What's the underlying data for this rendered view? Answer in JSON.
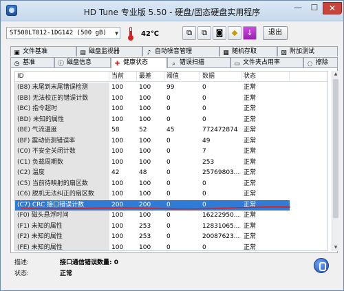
{
  "window": {
    "title": "HD Tune 专业版 5.50 - 硬盘/固态硬盘实用程序"
  },
  "titlebar_buttons": {
    "minimize": "—",
    "maximize": "☐",
    "close": "✕"
  },
  "toolbar": {
    "drive": "ST500LT012-1DG142 (500 gB)",
    "temperature": "42℃",
    "exit_label": "退出",
    "tool_icons": [
      "copy-icon",
      "copy-icon",
      "camera-icon",
      "save-icon",
      "download-icon"
    ],
    "tool_glyphs": [
      "⧉",
      "⧉",
      "◙",
      "◆",
      "↓"
    ]
  },
  "tabs_row1": [
    {
      "label": "文件基准",
      "icon": "file-benchmark-icon",
      "glyph": "▣"
    },
    {
      "label": "磁盘监视器",
      "icon": "disk-monitor-icon",
      "glyph": "▤"
    },
    {
      "label": "自动噪音管理",
      "icon": "noise-icon",
      "glyph": "♪"
    },
    {
      "label": "随机存取",
      "icon": "random-access-icon",
      "glyph": "▦"
    },
    {
      "label": "附加测试",
      "icon": "extra-tests-icon",
      "glyph": "▧"
    }
  ],
  "tabs_row2": [
    {
      "label": "基准",
      "icon": "benchmark-icon",
      "glyph": "◷"
    },
    {
      "label": "磁盘信息",
      "icon": "disk-info-icon",
      "glyph": "ⓘ"
    },
    {
      "label": "健康状态",
      "icon": "health-icon",
      "glyph": "✚"
    },
    {
      "label": "错误扫描",
      "icon": "error-scan-icon",
      "glyph": "⌕"
    },
    {
      "label": "文件夹占用率",
      "icon": "folder-usage-icon",
      "glyph": "▭"
    },
    {
      "label": "擦除",
      "icon": "erase-icon",
      "glyph": "◌"
    }
  ],
  "active_tab": "健康状态",
  "table": {
    "headers": [
      "ID",
      "当前",
      "最差",
      "阈值",
      "数据",
      "状态"
    ],
    "rows": [
      [
        "(B8) 末尾到末尾错误检测",
        "100",
        "100",
        "99",
        "0",
        "正常"
      ],
      [
        "(BB) 无法校正的错误计数",
        "100",
        "100",
        "0",
        "0",
        "正常"
      ],
      [
        "(BC) 指令超时",
        "100",
        "100",
        "0",
        "0",
        "正常"
      ],
      [
        "(BD) 未知的属性",
        "100",
        "100",
        "0",
        "0",
        "正常"
      ],
      [
        "(BE) 气流温度",
        "58",
        "52",
        "45",
        "772472874",
        "正常"
      ],
      [
        "(BF) 震动侦测错误率",
        "100",
        "100",
        "0",
        "49",
        "正常"
      ],
      [
        "(C0) 不安全关闭计数",
        "100",
        "100",
        "0",
        "7",
        "正常"
      ],
      [
        "(C1) 负载周期数",
        "100",
        "100",
        "0",
        "253",
        "正常"
      ],
      [
        "(C2) 温度",
        "42",
        "48",
        "0",
        "25769803...",
        "正常"
      ],
      [
        "(C5) 当前待映射的扇区数",
        "100",
        "100",
        "0",
        "0",
        "正常"
      ],
      [
        "(C6) 脱机无法纠正的扇区数",
        "100",
        "100",
        "0",
        "0",
        "正常"
      ],
      [
        "(C7) CRC 接口错误计数",
        "200",
        "200",
        "0",
        "0",
        "正常"
      ],
      [
        "(F0) 磁头悬浮时间",
        "100",
        "100",
        "0",
        "16222950...",
        "正常"
      ],
      [
        "(F1) 未知的属性",
        "100",
        "253",
        "0",
        "12831065...",
        "正常"
      ],
      [
        "(F2) 未知的属性",
        "100",
        "253",
        "0",
        "20087623...",
        "正常"
      ],
      [
        "(FE) 未知的属性",
        "100",
        "100",
        "0",
        "0",
        "正常"
      ]
    ],
    "selected_row": 11
  },
  "info": {
    "desc_label": "描述:",
    "desc_value": "接口通信错误数量: 0",
    "status_label": "状态:",
    "status_value": "正常"
  },
  "colors": {
    "selection": "#2f7bd6",
    "annotation": "#d62020"
  }
}
